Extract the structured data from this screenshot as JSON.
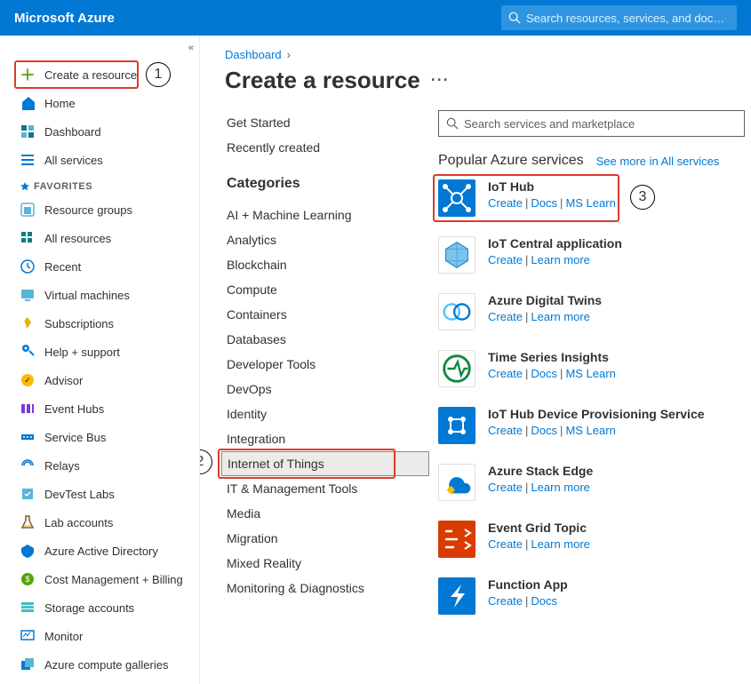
{
  "header": {
    "brand": "Microsoft Azure",
    "search_placeholder": "Search resources, services, and docs (G+/)"
  },
  "sidebar": {
    "create_label": "Create a resource",
    "top": [
      {
        "label": "Home",
        "icon": "home"
      },
      {
        "label": "Dashboard",
        "icon": "dashboard"
      },
      {
        "label": "All services",
        "icon": "allservices"
      }
    ],
    "favorites_label": "FAVORITES",
    "favorites": [
      {
        "label": "Resource groups",
        "icon": "resourcegroup"
      },
      {
        "label": "All resources",
        "icon": "grid"
      },
      {
        "label": "Recent",
        "icon": "clock"
      },
      {
        "label": "Virtual machines",
        "icon": "vm"
      },
      {
        "label": "Subscriptions",
        "icon": "key"
      },
      {
        "label": "Help + support",
        "icon": "help"
      },
      {
        "label": "Advisor",
        "icon": "advisor"
      },
      {
        "label": "Event Hubs",
        "icon": "eventhubs"
      },
      {
        "label": "Service Bus",
        "icon": "servicebus"
      },
      {
        "label": "Relays",
        "icon": "relay"
      },
      {
        "label": "DevTest Labs",
        "icon": "devtest"
      },
      {
        "label": "Lab accounts",
        "icon": "lab"
      },
      {
        "label": "Azure Active Directory",
        "icon": "aad"
      },
      {
        "label": "Cost Management + Billing",
        "icon": "cost"
      },
      {
        "label": "Storage accounts",
        "icon": "storage"
      },
      {
        "label": "Monitor",
        "icon": "monitor"
      },
      {
        "label": "Azure compute galleries",
        "icon": "gallery"
      }
    ]
  },
  "content": {
    "breadcrumb": [
      "Dashboard"
    ],
    "title": "Create a resource",
    "left_links": [
      "Get Started",
      "Recently created"
    ],
    "categories_label": "Categories",
    "categories": [
      "AI + Machine Learning",
      "Analytics",
      "Blockchain",
      "Compute",
      "Containers",
      "Databases",
      "Developer Tools",
      "DevOps",
      "Identity",
      "Integration",
      "Internet of Things",
      "IT & Management Tools",
      "Media",
      "Migration",
      "Mixed Reality",
      "Monitoring & Diagnostics"
    ],
    "selected_category": "Internet of Things",
    "search_placeholder": "Search services and marketplace",
    "popular_label": "Popular Azure services",
    "see_more_label": "See more in All services",
    "services": [
      {
        "name": "IoT Hub",
        "links": [
          "Create",
          "Docs",
          "MS Learn"
        ],
        "tile_bg": "#0078d4",
        "icon": "iothub",
        "highlight": true
      },
      {
        "name": "IoT Central application",
        "links": [
          "Create",
          "Learn more"
        ],
        "tile_bg": "#ffffff",
        "icon": "iotcentral"
      },
      {
        "name": "Azure Digital Twins",
        "links": [
          "Create",
          "Learn more"
        ],
        "tile_bg": "#ffffff",
        "icon": "digitaltwins"
      },
      {
        "name": "Time Series Insights",
        "links": [
          "Create",
          "Docs",
          "MS Learn"
        ],
        "tile_bg": "#ffffff",
        "icon": "tsi"
      },
      {
        "name": "IoT Hub Device Provisioning Service",
        "links": [
          "Create",
          "Docs",
          "MS Learn"
        ],
        "tile_bg": "#0078d4",
        "icon": "dps"
      },
      {
        "name": "Azure Stack Edge",
        "links": [
          "Create",
          "Learn more"
        ],
        "tile_bg": "#ffffff",
        "icon": "stackedge"
      },
      {
        "name": "Event Grid Topic",
        "links": [
          "Create",
          "Learn more"
        ],
        "tile_bg": "#da3b01",
        "icon": "eventgrid"
      },
      {
        "name": "Function App",
        "links": [
          "Create",
          "Docs"
        ],
        "tile_bg": "#0078d4",
        "icon": "function"
      }
    ]
  },
  "markers": {
    "1": "1",
    "2": "2",
    "3": "3"
  },
  "colors": {
    "azure_blue": "#0078d4",
    "link": "#0078d4",
    "highlight": "#dc3b2e"
  }
}
